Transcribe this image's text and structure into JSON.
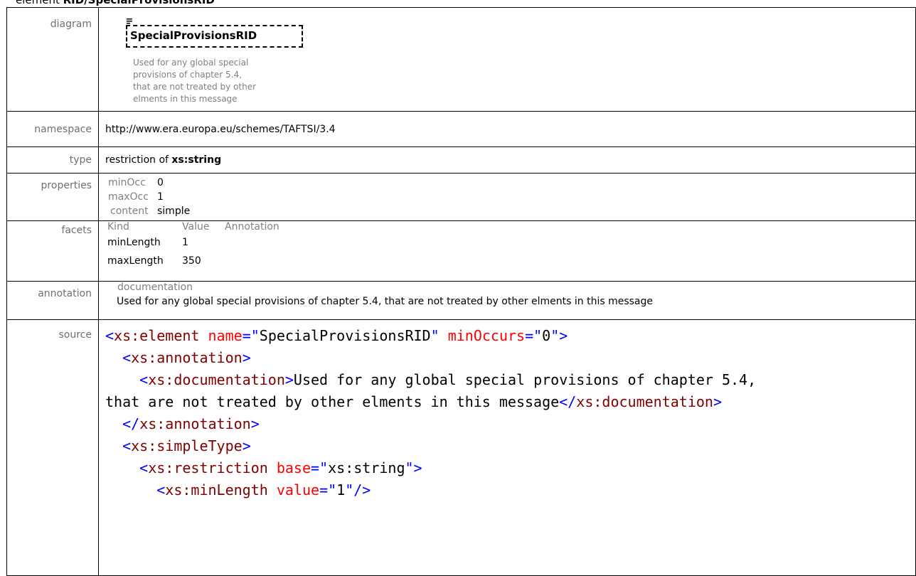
{
  "heading": {
    "prefix": "element ",
    "name": "RID/SpecialProvisionsRID"
  },
  "rows": {
    "diagram": {
      "label": "diagram",
      "element_name": "SpecialProvisionsRID",
      "doc_lines": [
        "Used for any global special",
        "provisions of chapter 5.4,",
        "that are not treated by other",
        "elments in this message"
      ]
    },
    "namespace": {
      "label": "namespace",
      "value": "http://www.era.europa.eu/schemes/TAFTSI/3.4"
    },
    "type": {
      "label": "type",
      "prefix": "restriction of ",
      "base": "xs:string"
    },
    "properties": {
      "label": "properties",
      "items": [
        {
          "key": "minOcc",
          "value": "0"
        },
        {
          "key": "maxOcc",
          "value": "1"
        },
        {
          "key": "content",
          "value": "simple"
        }
      ]
    },
    "facets": {
      "label": "facets",
      "headers": [
        "Kind",
        "Value",
        "Annotation"
      ],
      "items": [
        {
          "kind": "minLength",
          "value": "1"
        },
        {
          "kind": "maxLength",
          "value": "350"
        }
      ]
    },
    "annotation": {
      "label": "annotation",
      "title": "documentation",
      "text": "Used for any global special provisions of chapter 5.4, that are not treated by other elments in this message"
    },
    "source": {
      "label": "source",
      "lines": [
        "<xs:element name=\"SpecialProvisionsRID\" minOccurs=\"0\">",
        "  <xs:annotation>",
        "    <xs:documentation>Used for any global special provisions of chapter 5.4,",
        "that are not treated by other elments in this message</xs:documentation>",
        "  </xs:annotation>",
        "  <xs:simpleType>",
        "    <xs:restriction base=\"xs:string\">",
        "      <xs:minLength value=\"1\"/>"
      ]
    }
  }
}
